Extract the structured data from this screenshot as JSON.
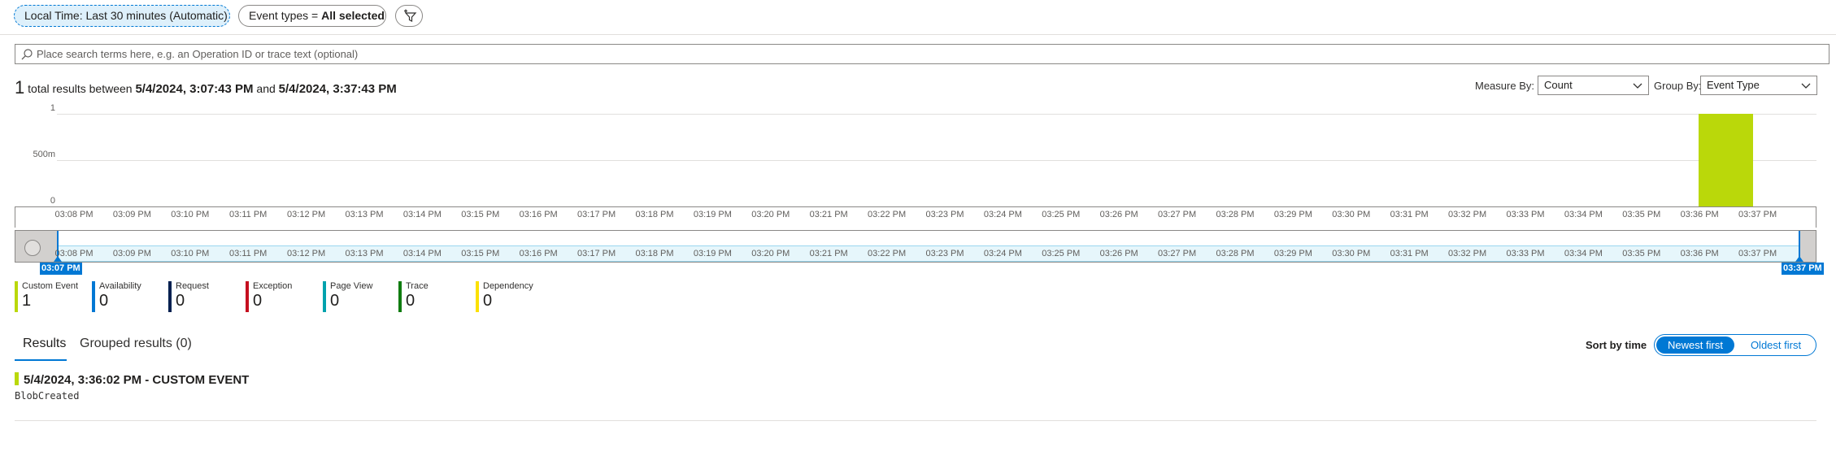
{
  "filters": {
    "time_pill": "Local Time: Last 30 minutes (Automatic)",
    "event_types_prefix": "Event types = ",
    "event_types_value": "All selected"
  },
  "search": {
    "placeholder": "Place search terms here, e.g. an Operation ID or trace text (optional)"
  },
  "summary": {
    "count": "1",
    "text1": " total results between ",
    "start": "5/4/2024, 3:07:43 PM",
    "text2": " and ",
    "end": "5/4/2024, 3:37:43 PM"
  },
  "controls": {
    "measure_label": "Measure By:",
    "measure_value": "Count",
    "group_label": "Group By:",
    "group_value": "Event Type"
  },
  "chart_data": {
    "type": "bar",
    "x": [
      "03:08 PM",
      "03:09 PM",
      "03:10 PM",
      "03:11 PM",
      "03:12 PM",
      "03:13 PM",
      "03:14 PM",
      "03:15 PM",
      "03:16 PM",
      "03:17 PM",
      "03:18 PM",
      "03:19 PM",
      "03:20 PM",
      "03:21 PM",
      "03:22 PM",
      "03:23 PM",
      "03:24 PM",
      "03:25 PM",
      "03:26 PM",
      "03:27 PM",
      "03:28 PM",
      "03:29 PM",
      "03:30 PM",
      "03:31 PM",
      "03:32 PM",
      "03:33 PM",
      "03:34 PM",
      "03:35 PM",
      "03:36 PM",
      "03:37 PM"
    ],
    "series": [
      {
        "name": "Custom Event",
        "color": "#bad80a",
        "values": [
          0,
          0,
          0,
          0,
          0,
          0,
          0,
          0,
          0,
          0,
          0,
          0,
          0,
          0,
          0,
          0,
          0,
          0,
          0,
          0,
          0,
          0,
          0,
          0,
          0,
          0,
          0,
          0,
          1,
          0
        ]
      }
    ],
    "yticks": [
      "1",
      "500m",
      "0"
    ],
    "ylim": [
      0,
      1
    ],
    "grid": true
  },
  "brush": {
    "start_label": "03:07 PM",
    "end_label": "03:37 PM"
  },
  "legend": [
    {
      "name": "Custom Event",
      "value": "1",
      "color": "#bad80a"
    },
    {
      "name": "Availability",
      "value": "0",
      "color": "#0078d4"
    },
    {
      "name": "Request",
      "value": "0",
      "color": "#002050"
    },
    {
      "name": "Exception",
      "value": "0",
      "color": "#c50f1f"
    },
    {
      "name": "Page View",
      "value": "0",
      "color": "#00a2ad"
    },
    {
      "name": "Trace",
      "value": "0",
      "color": "#107c10"
    },
    {
      "name": "Dependency",
      "value": "0",
      "color": "#fce100"
    }
  ],
  "tabs": {
    "results": "Results",
    "grouped": "Grouped results (0)"
  },
  "sort": {
    "label": "Sort by time",
    "newest": "Newest first",
    "oldest": "Oldest first"
  },
  "result": {
    "title": "5/4/2024, 3:36:02 PM - CUSTOM EVENT",
    "subtitle": "BlobCreated"
  }
}
